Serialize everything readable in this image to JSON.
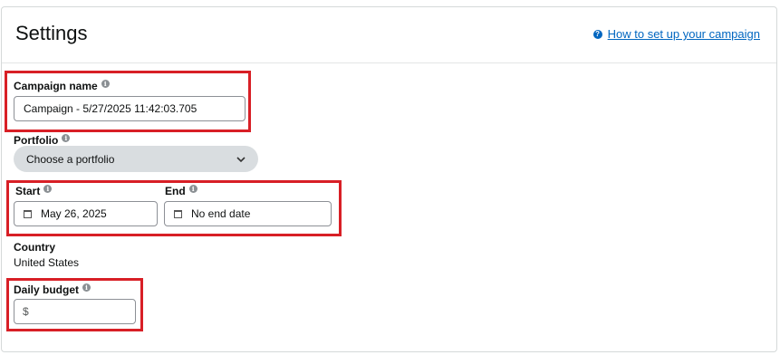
{
  "header": {
    "title": "Settings",
    "help_link": "How to set up your campaign",
    "help_icon": "question-circle-icon"
  },
  "campaign_name": {
    "label": "Campaign name",
    "value": "Campaign - 5/27/2025 11:42:03.705"
  },
  "portfolio": {
    "label": "Portfolio",
    "selected": "Choose a portfolio"
  },
  "start": {
    "label": "Start",
    "value": "May 26, 2025"
  },
  "end": {
    "label": "End",
    "value": "No end date"
  },
  "country": {
    "label": "Country",
    "value": "United States"
  },
  "daily_budget": {
    "label": "Daily budget",
    "currency_symbol": "$",
    "value": ""
  },
  "colors": {
    "highlight": "#d81f26",
    "link": "#0066c0",
    "dropdown_bg": "#d9dde0"
  }
}
